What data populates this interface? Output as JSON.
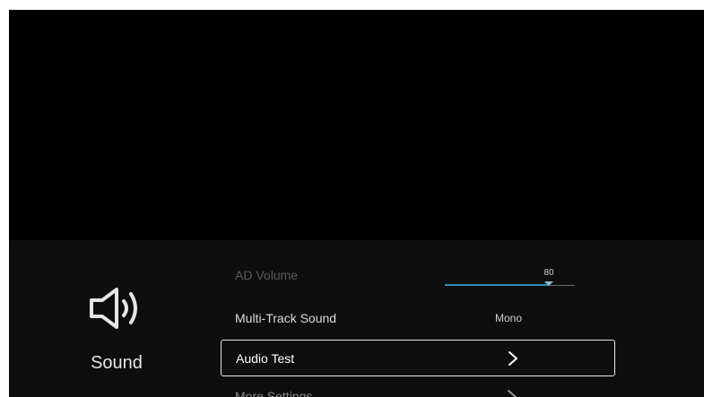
{
  "category": {
    "icon": "speaker-icon",
    "label": "Sound"
  },
  "menu": {
    "items": [
      {
        "label": "AD Volume",
        "type": "slider",
        "value": "80",
        "level": 0.8
      },
      {
        "label": "Multi-Track Sound",
        "type": "value",
        "value": "Mono"
      },
      {
        "label": "Audio Test",
        "type": "submenu",
        "icon": "chevron-right-icon",
        "selected": true
      },
      {
        "label": "More Settings",
        "type": "submenu",
        "icon": "chevron-right-icon"
      }
    ]
  },
  "colors": {
    "background": "#000000",
    "panel": "#0e0e0f",
    "accent": "#2a8fb3",
    "selection_border": "#e8e8e8"
  }
}
